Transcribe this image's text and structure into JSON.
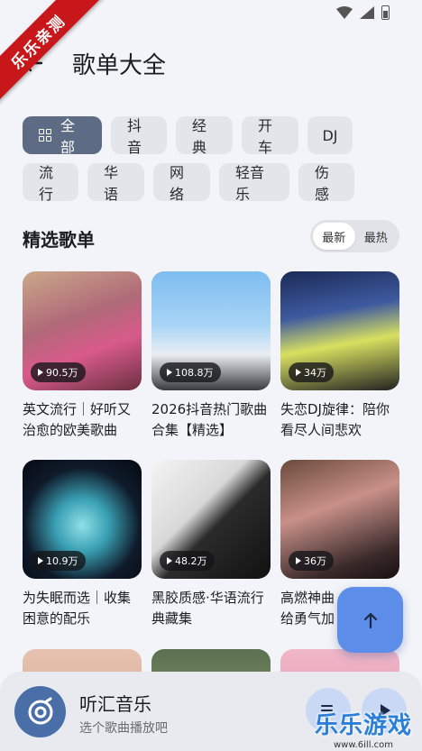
{
  "ribbon": "乐乐亲测",
  "header": {
    "title": "歌单大全"
  },
  "chips": {
    "row1": [
      "全部",
      "抖音",
      "经典",
      "开车",
      "DJ"
    ],
    "row2": [
      "流行",
      "华语",
      "网络",
      "轻音乐",
      "伤感"
    ]
  },
  "section": {
    "title": "精选歌单",
    "sort_latest": "最新",
    "sort_hot": "最热"
  },
  "playlists": [
    {
      "plays": "90.5万",
      "title": "英文流行｜好听又治愈的欧美歌曲"
    },
    {
      "plays": "108.8万",
      "title": "2026抖音热门歌曲合集【精选】"
    },
    {
      "plays": "34万",
      "title": "失恋DJ旋律：陪你看尽人间悲欢"
    },
    {
      "plays": "10.9万",
      "title": "为失眠而选｜收集困意的配乐"
    },
    {
      "plays": "48.2万",
      "title": "黑胶质感·华语流行典藏集"
    },
    {
      "plays": "36万",
      "title": "高燃神曲给勇气加"
    }
  ],
  "player": {
    "name": "听汇音乐",
    "subtitle": "选个歌曲播放吧"
  },
  "watermark": {
    "text": "乐乐游戏",
    "url": "www.6ill.com"
  },
  "colors": {
    "accent": "#5c8de8",
    "active_chip": "#5e6b85",
    "ribbon": "#c8171b"
  }
}
